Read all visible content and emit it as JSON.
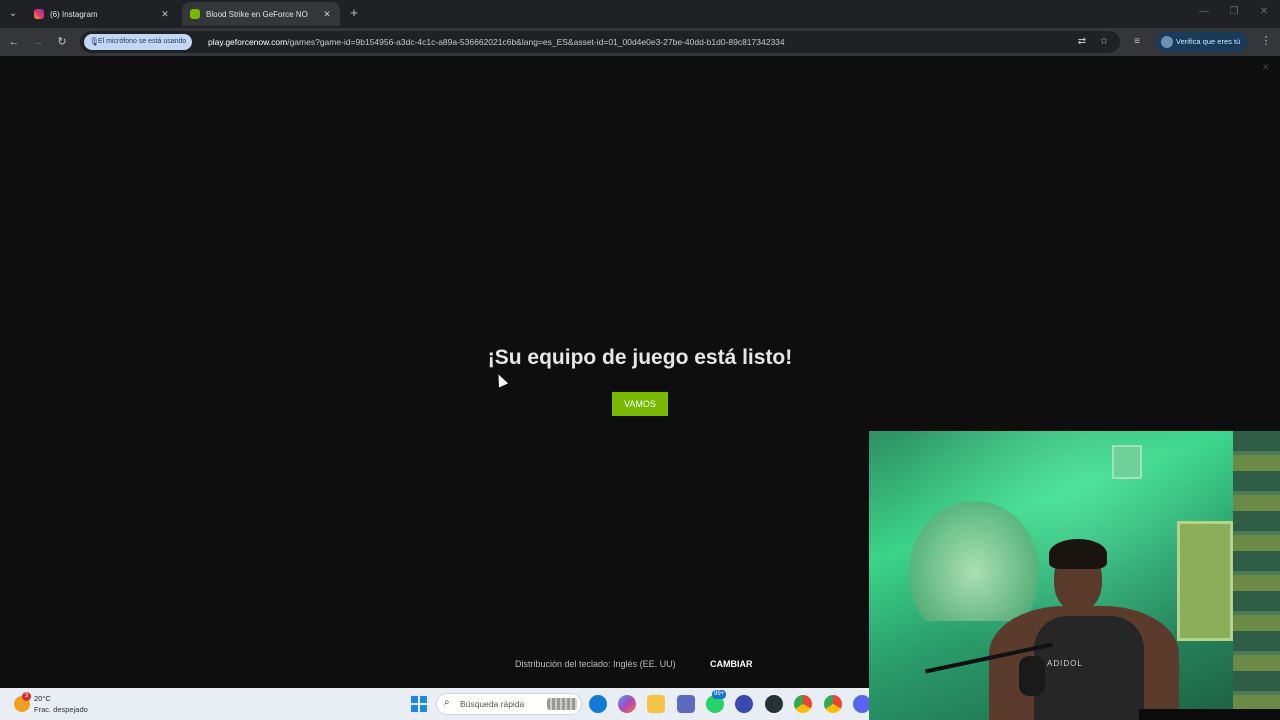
{
  "browser": {
    "tabs": [
      {
        "title": "(6) Instagram",
        "active": false
      },
      {
        "title": "Blood Strike en GeForce NO",
        "active": true
      }
    ],
    "mic_chip": "El micrófono se está usando",
    "url_host": "play.geforcenow.com",
    "url_rest": "/games?game-id=9b154956-a3dc-4c1c-a89a-536662021c6b&lang=es_ES&asset-id=01_00d4e0e3-27be-40dd-b1d0-89c817342334",
    "profile_chip": "Verifica que eres tú"
  },
  "page": {
    "headline": "¡Su equipo de juego está listo!",
    "primary_button": "VAMOS",
    "keyboard_label": "Distribución del teclado: Inglés (EE. UU)",
    "keyboard_change": "CAMBIAR"
  },
  "taskbar": {
    "weather_temp": "20°C",
    "weather_condition": "Frac. despejado",
    "weather_badge": "3",
    "search_placeholder": "Búsqueda rápida",
    "whatsapp_badge": "99+"
  },
  "webcam": {
    "shirt_text": "ADIDOL"
  },
  "colors": {
    "accent": "#76b900",
    "page_bg": "#0e0e0e",
    "browser_bg": "#202124"
  }
}
